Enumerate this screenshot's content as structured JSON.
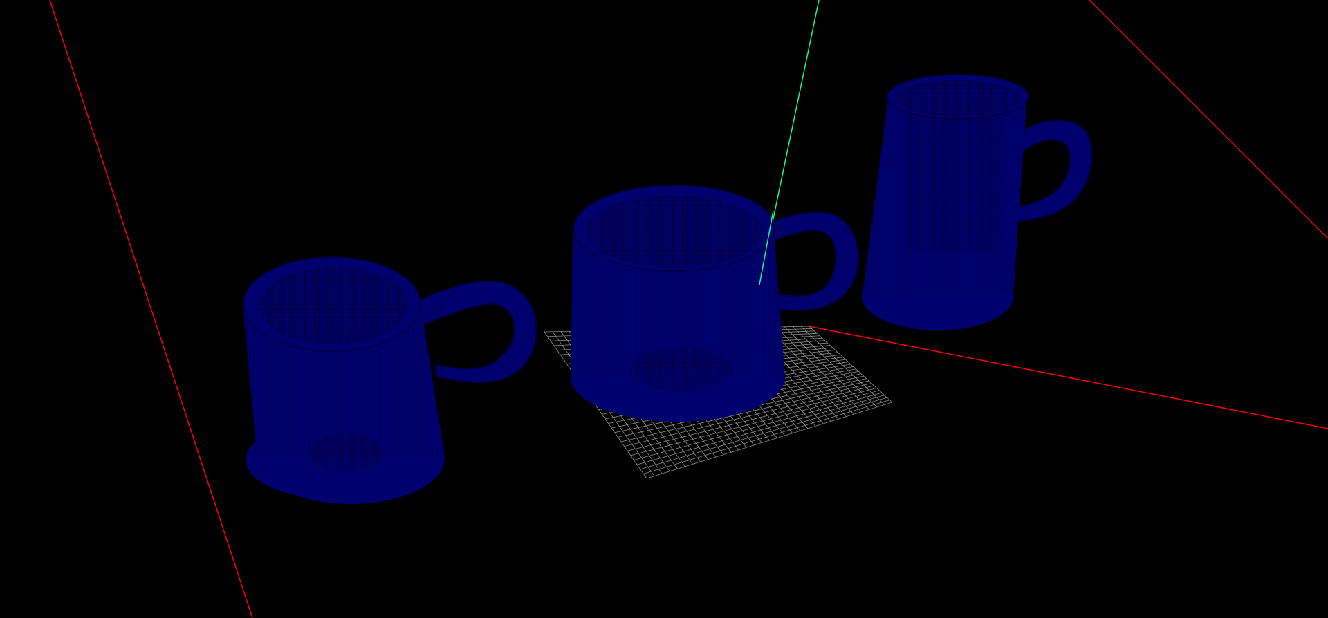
{
  "viewport": {
    "background": "#000000",
    "view_mode": "wireframe"
  },
  "scene": {
    "object_count": 3,
    "objects": [
      {
        "kind": "mug",
        "shape": "short-wide",
        "color": "#00006e"
      },
      {
        "kind": "mug",
        "shape": "short-wide",
        "color": "#00006e",
        "selected": true
      },
      {
        "kind": "mug",
        "shape": "tall-narrow",
        "color": "#00006e"
      }
    ]
  },
  "axes": {
    "x_axis_color": "#ff0000",
    "y_axis_color": "#00ff99",
    "ground_grid_color": "#8c8c8c",
    "grid_visible": true
  }
}
